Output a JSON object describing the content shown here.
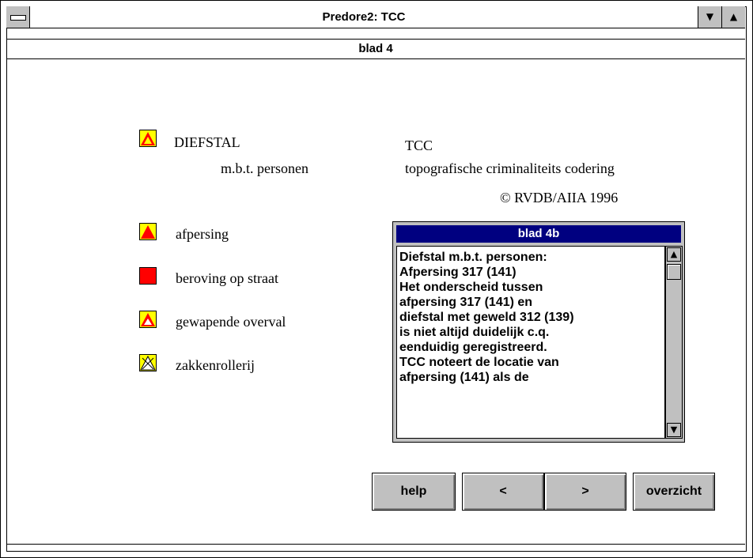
{
  "window": {
    "title": "Predore2: TCC",
    "minimize_glyph": "▼",
    "maximize_glyph": "▲"
  },
  "page": {
    "subtitle": "blad 4"
  },
  "category": {
    "title": "DIEFSTAL",
    "subtitle": "m.b.t. personen",
    "icon": "triangle-yellow-red-icon"
  },
  "tcc": {
    "abbrev": "TCC",
    "full": "topografische criminaliteits codering",
    "copyright": "© RVDB/AIIA 1996"
  },
  "legend": [
    {
      "label": "afpersing",
      "icon": "filled-red-triangle-icon",
      "bg": "#ffff00",
      "tri": "#ff0000"
    },
    {
      "label": "beroving op straat",
      "icon": "filled-red-triangle-red-bg-icon",
      "bg": "#ff0000",
      "tri": "#ffff00"
    },
    {
      "label": "gewapende overval",
      "icon": "hollow-red-triangle-icon",
      "bg": "#ffff00",
      "tri": "#ff0000"
    },
    {
      "label": "zakkenrollerij",
      "icon": "crossed-triangle-icon",
      "bg": "#ffff00",
      "tri": "#ffffff"
    }
  ],
  "panel": {
    "title": "blad 4b",
    "lines": [
      "Diefstal m.b.t. personen:",
      "Afpersing 317 (141)",
      "",
      "Het onderscheid tussen",
      "afpersing 317 (141) en",
      "diefstal met geweld 312 (139)",
      "is niet altijd duidelijk c.q.",
      "eenduidig geregistreerd.",
      "",
      "TCC noteert de locatie van",
      "afpersing (141) als de"
    ],
    "scroll_up": "▲",
    "scroll_down": "▼"
  },
  "buttons": {
    "help": "help",
    "prev": "<",
    "next": ">",
    "overview": "overzicht"
  }
}
